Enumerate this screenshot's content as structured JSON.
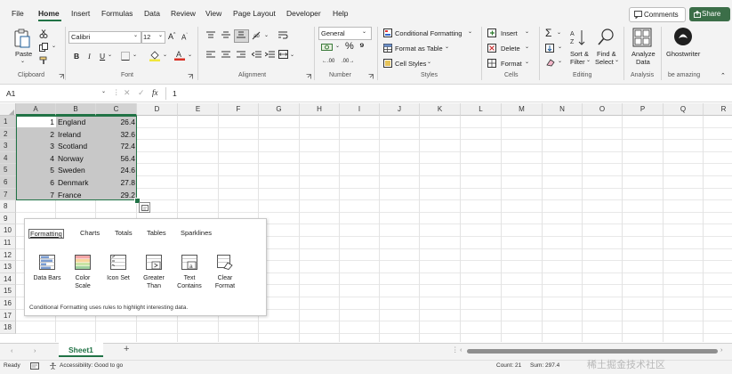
{
  "menu": {
    "tabs": [
      "File",
      "Home",
      "Insert",
      "Formulas",
      "Data",
      "Review",
      "View",
      "Page Layout",
      "Developer",
      "Help"
    ],
    "comments_label": "Comments",
    "share_label": "Share"
  },
  "ribbon": {
    "clipboard": {
      "paste": "Paste",
      "label": "Clipboard"
    },
    "font": {
      "name": "Calibri",
      "size": "12",
      "label": "Font"
    },
    "alignment": {
      "label": "Alignment"
    },
    "number": {
      "format": "General",
      "label": "Number"
    },
    "styles": {
      "conditional": "Conditional Formatting",
      "format_table": "Format as Table",
      "cell_styles": "Cell Styles",
      "label": "Styles"
    },
    "cells": {
      "insert": "Insert",
      "delete": "Delete",
      "format": "Format",
      "label": "Cells"
    },
    "editing": {
      "sort_l1": "Sort &",
      "sort_l2": "Filter",
      "find_l1": "Find &",
      "find_l2": "Select",
      "label": "Editing"
    },
    "analysis": {
      "analyze_l1": "Analyze",
      "analyze_l2": "Data",
      "label": "Analysis"
    },
    "ghostwriter": {
      "name": "Ghostwriter",
      "label": "be amazing"
    }
  },
  "formula_bar": {
    "name_box": "A1",
    "fx": "fx",
    "value": "1"
  },
  "columns": [
    "A",
    "B",
    "C",
    "D",
    "E",
    "F",
    "G",
    "H",
    "I",
    "J",
    "K",
    "L",
    "M",
    "N",
    "O",
    "P",
    "Q",
    "R"
  ],
  "rows": [
    "1",
    "2",
    "3",
    "4",
    "5",
    "6",
    "7",
    "8",
    "9",
    "10",
    "11",
    "12",
    "13",
    "14",
    "15",
    "16",
    "17",
    "18"
  ],
  "data": [
    {
      "a": "1",
      "b": "England",
      "c": "26.4"
    },
    {
      "a": "2",
      "b": "Ireland",
      "c": "32.6"
    },
    {
      "a": "3",
      "b": "Scotland",
      "c": "72.4"
    },
    {
      "a": "4",
      "b": "Norway",
      "c": "56.4"
    },
    {
      "a": "5",
      "b": "Sweden",
      "c": "24.6"
    },
    {
      "a": "6",
      "b": "Denmark",
      "c": "27.8"
    },
    {
      "a": "7",
      "b": "France",
      "c": "29.2"
    }
  ],
  "quick_analysis": {
    "tabs": [
      "Formatting",
      "Charts",
      "Totals",
      "Tables",
      "Sparklines"
    ],
    "options": [
      {
        "l1": "Data Bars",
        "l2": ""
      },
      {
        "l1": "Color",
        "l2": "Scale"
      },
      {
        "l1": "Icon Set",
        "l2": ""
      },
      {
        "l1": "Greater",
        "l2": "Than"
      },
      {
        "l1": "Text",
        "l2": "Contains"
      },
      {
        "l1": "Clear",
        "l2": "Format"
      }
    ],
    "description": "Conditional Formatting uses rules to highlight interesting data."
  },
  "sheets": {
    "active": "Sheet1",
    "add": "+"
  },
  "status": {
    "ready": "Ready",
    "accessibility": "Accessibility: Good to go",
    "count": "Count: 21",
    "sum": "Sum: 297.4",
    "watermark": "稀土掘金技术社区"
  },
  "colors": {
    "accent": "#217346",
    "share": "#3b6e48",
    "selection": "#c8c8c8"
  }
}
